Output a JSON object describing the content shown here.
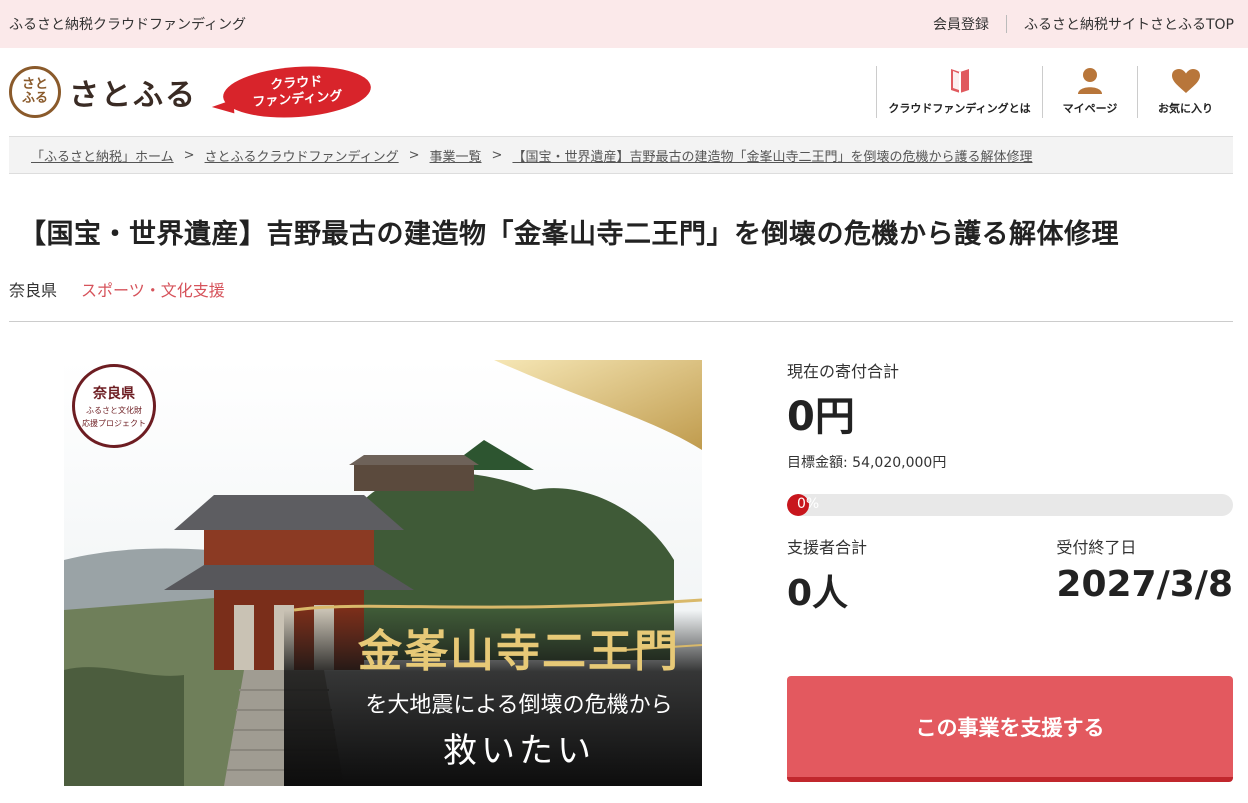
{
  "topbar": {
    "site_name": "ふるさと納税クラウドファンディング",
    "register": "会員登録",
    "satofull_top": "ふるさと納税サイトさとふるTOP"
  },
  "header": {
    "logo_seal": "さとふる",
    "brand": "さとふる",
    "badge_line1": "クラウド",
    "badge_line2": "ファンディング",
    "nav": [
      {
        "label": "クラウドファンディングとは",
        "icon": "book-icon"
      },
      {
        "label": "マイページ",
        "icon": "user-icon"
      },
      {
        "label": "お気に入り",
        "icon": "heart-icon"
      }
    ]
  },
  "breadcrumb": [
    "「ふるさと納税」ホーム",
    "さとふるクラウドファンディング",
    "事業一覧",
    "【国宝・世界遺産】吉野最古の建造物「金峯山寺二王門」を倒壊の危機から護る解体修理"
  ],
  "breadcrumb_separator": ">",
  "project": {
    "title": "【国宝・世界遺産】吉野最古の建造物「金峯山寺二王門」を倒壊の危機から護る解体修理",
    "prefecture": "奈良県",
    "category": "スポーツ・文化支援"
  },
  "hero": {
    "seal_pref": "奈良県",
    "seal_sub1": "ふるさと文化財",
    "seal_sub2": "応援プロジェクト",
    "headline": "金峯山寺二王門",
    "subline": "を大地震による倒壊の危機から",
    "tagline": "救いたい"
  },
  "funding": {
    "current_label": "現在の寄付合計",
    "current_amount": "0円",
    "goal_text": "目標金額: 54,020,000円",
    "progress_percent": 0,
    "progress_label": "0%",
    "supporters_label": "支援者合計",
    "supporters": "0人",
    "deadline_label": "受付終了日",
    "deadline": "2027/3/8",
    "cta_label": "この事業を支援する"
  },
  "colors": {
    "topbar_bg": "#fbe9ea",
    "accent_red": "#d8242b",
    "category": "#d6535b",
    "cta": "#e3595f",
    "progress_fill": "#c8161d"
  }
}
